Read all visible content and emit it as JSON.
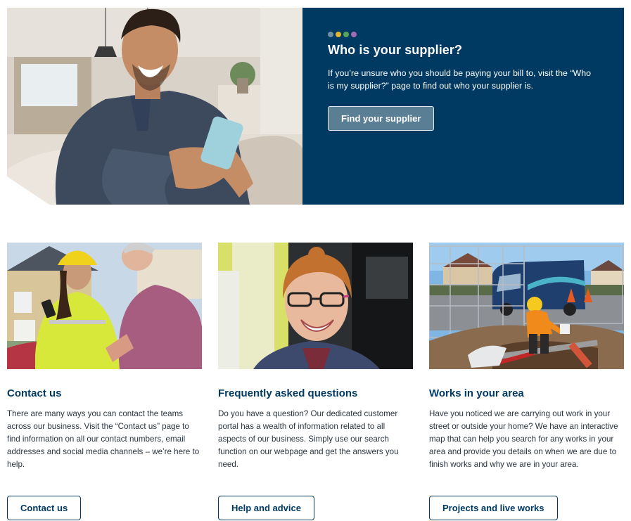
{
  "hero": {
    "title": "Who is your supplier?",
    "text": "If you’re unsure who you should be paying your bill to, visit the “Who is my supplier?” page to find out who your supplier is.",
    "button_label": "Find your supplier",
    "dot_colors": [
      "#6b8ea3",
      "#e2b52c",
      "#5aa35a",
      "#a36bb4"
    ],
    "panel_color": "#003a63",
    "image": "man-smiling-using-phone-on-sofa"
  },
  "cards": [
    {
      "title": "Contact us",
      "text": "There are many ways you can contact the teams across our business. Visit the “Contact us” page to find information on all our contact numbers, email addresses and social media channels – we’re here to help.",
      "button_label": "Contact us",
      "image": "engineer-in-hard-hat-talking-to-customer"
    },
    {
      "title": "Frequently asked questions",
      "text": "Do you have a question? Our dedicated customer portal has a wealth of information related to all aspects of our business. Simply use our search function on our webpage and get the answers you need.",
      "button_label": "Help and advice",
      "image": "smiling-woman-with-glasses-in-office"
    },
    {
      "title": "Works in your area",
      "text": "Have you noticed we are carrying out work in your street or outside your home? We have an interactive map that can help you search for any works in your area and provide you details on when we are due to finish works and why we are in your area.",
      "button_label": "Projects and live works",
      "image": "engineer-working-in-street-excavation-with-van"
    }
  ],
  "colors": {
    "brand_navy": "#003a63",
    "button_grey_blue": "#5a7f95"
  }
}
